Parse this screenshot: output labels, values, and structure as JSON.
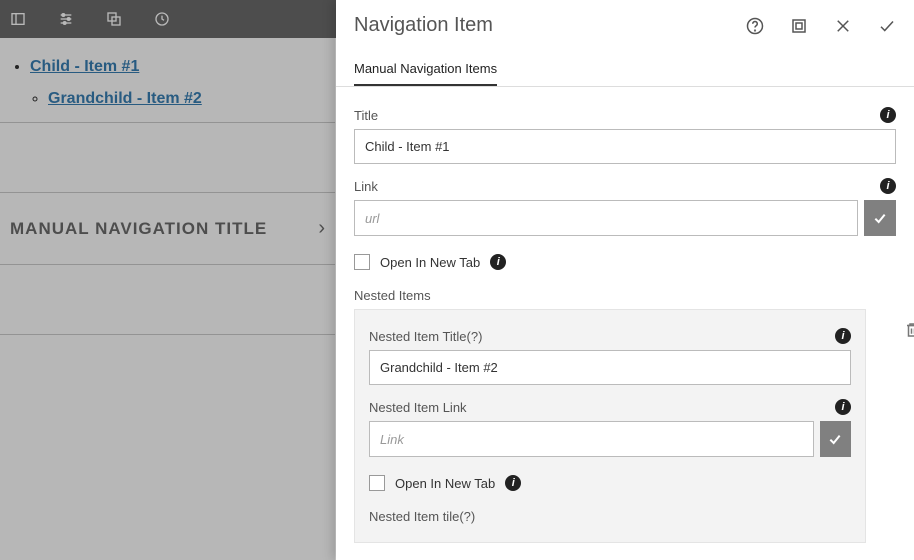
{
  "toolbar": {
    "icons": [
      "panel-icon",
      "sliders-icon",
      "layers-icon",
      "sync-icon"
    ]
  },
  "leftNav": {
    "child_label": "Child - Item #1",
    "grandchild_label": "Grandchild - Item #2",
    "manual_title": "MANUAL NAVIGATION TITLE"
  },
  "dialog": {
    "title": "Navigation Item",
    "tab_label": "Manual Navigation Items",
    "fields": {
      "title_label": "Title",
      "title_value": "Child - Item #1",
      "link_label": "Link",
      "link_placeholder": "url",
      "open_new_tab_label": "Open In New Tab",
      "nested_header": "Nested Items",
      "nested_title_label": "Nested Item Title(?)",
      "nested_title_value": "Grandchild - Item #2",
      "nested_link_label": "Nested Item Link",
      "nested_link_placeholder": "Link",
      "nested_open_new_tab_label": "Open In New Tab",
      "nested_tile_label": "Nested Item tile(?)"
    }
  }
}
